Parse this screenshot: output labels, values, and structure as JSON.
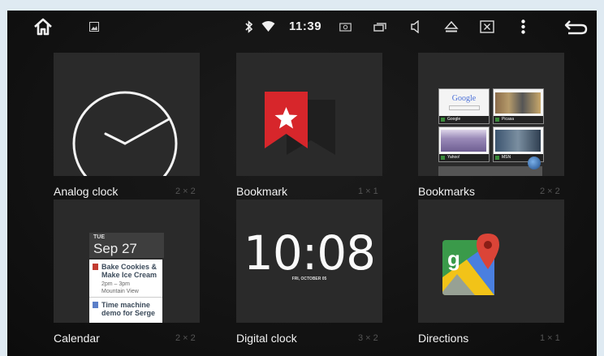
{
  "statusbar": {
    "time": "11:39",
    "icons": [
      "home-icon",
      "gallery-icon",
      "bluetooth-icon",
      "wifi-icon",
      "screenshot-icon",
      "recent-apps-icon",
      "volume-icon",
      "eject-icon",
      "close-window-icon",
      "menu-icon",
      "back-icon"
    ]
  },
  "widgets": [
    {
      "label": "Analog clock",
      "size": "2 × 2"
    },
    {
      "label": "Bookmark",
      "size": "1 × 1"
    },
    {
      "label": "Bookmarks",
      "size": "2 × 2"
    },
    {
      "label": "Calendar",
      "size": "2 × 2"
    },
    {
      "label": "Digital clock",
      "size": "3 × 2"
    },
    {
      "label": "Directions",
      "size": "1 × 1"
    }
  ],
  "bookmarks_preview": [
    {
      "title": "Google",
      "label": "Google"
    },
    {
      "title": "",
      "label": "Picasa"
    },
    {
      "title": "",
      "label": "Yahoo!"
    },
    {
      "title": "",
      "label": "MSN"
    }
  ],
  "calendar_preview": {
    "day": "TUE",
    "date": "Sep 27",
    "events": [
      {
        "title1": "Bake Cookies &",
        "title2": "Make Ice Cream",
        "time": "2pm – 3pm",
        "place": "Mountain View",
        "color": "#c23b30"
      },
      {
        "title1": "Time machine",
        "title2": "demo for Serge",
        "color": "#5b7fc8"
      }
    ]
  },
  "digital_clock_preview": {
    "time": "10:08",
    "date": "FRI, OCTOBER 05"
  },
  "colors": {
    "bookmark_red": "#d7262b",
    "background": "#121212"
  }
}
